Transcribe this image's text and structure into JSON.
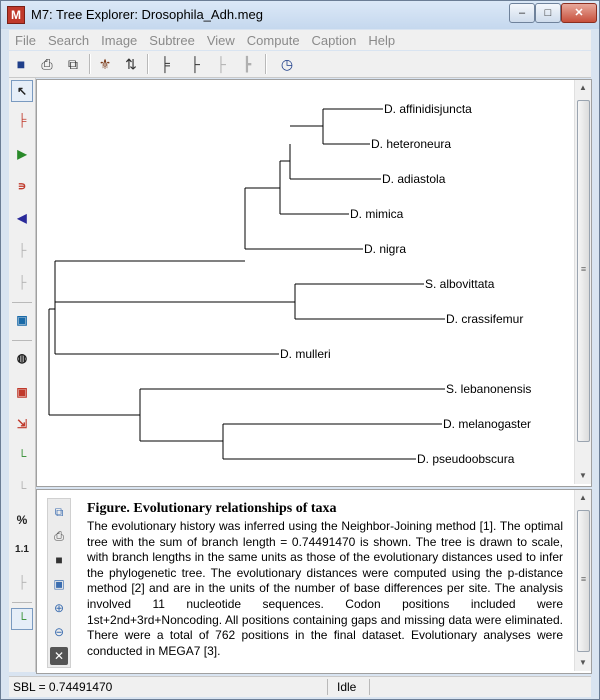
{
  "window": {
    "title": "M7: Tree Explorer: Drosophila_Adh.meg",
    "app_icon_letter": "M",
    "controls": {
      "minimize": "–",
      "maximize": "□",
      "close": "✕"
    }
  },
  "menubar": {
    "items": [
      "File",
      "Search",
      "Image",
      "Subtree",
      "View",
      "Compute",
      "Caption",
      "Help"
    ]
  },
  "toolbar": {
    "icons": [
      "save-icon",
      "print-icon",
      "copy-icon",
      "root-tree-icon",
      "flip-subtree-icon",
      "topology-icon",
      "subtree-icon",
      "swap-subtree-icon",
      "compress-subtree-icon",
      "timetree-icon"
    ]
  },
  "left_toolbar": {
    "icons": [
      "pointer-icon",
      "place-root-icon",
      "flip-subtree-icon",
      "swap-subtree-icon",
      "compress-subtree-icon",
      "fill-subtree-icon",
      "display-subtree-icon",
      "zoom-subtree-icon",
      "find-icon",
      "cluster-icon",
      "resize-icon",
      "node-icon",
      "branch-icon",
      "percent-icon",
      "scale-icon",
      "topology-icon",
      "edit-icon"
    ]
  },
  "tree": {
    "taxa": [
      "D. affinidisjuncta",
      "D. heteroneura",
      "D. adiastola",
      "D. mimica",
      "D. nigra",
      "S. albovittata",
      "D. crassifemur",
      "D. mulleri",
      "S. lebanonensis",
      "D. melanogaster",
      "D. pseudoobscura"
    ]
  },
  "caption": {
    "title": "Figure. Evolutionary relationships of taxa",
    "body": "The evolutionary history was inferred using the Neighbor-Joining method [1]. The optimal tree with the sum of branch length = 0.74491470 is shown. The tree is drawn to scale, with branch lengths in the same units as those of the evolutionary distances used to infer the phylogenetic tree. The evolutionary distances were computed using the p-distance method [2] and are in the units of the number of base differences per site. The analysis involved 11 nucleotide sequences. Codon positions included were 1st+2nd+3rd+Noncoding. All positions containing gaps and missing data were eliminated. There were a total of 762 positions in the final dataset. Evolutionary analyses were conducted in MEGA7 [3].",
    "tools": [
      "copy-icon",
      "print-icon",
      "save-icon",
      "font-icon",
      "zoom-in-icon",
      "zoom-out-icon",
      "close-icon"
    ]
  },
  "status": {
    "sbl": "SBL = 0.74491470",
    "state": "Idle"
  },
  "colors": {
    "window_frame": "#d9e4f1",
    "close_button": "#c7503c",
    "tree_lines": "#000000"
  }
}
